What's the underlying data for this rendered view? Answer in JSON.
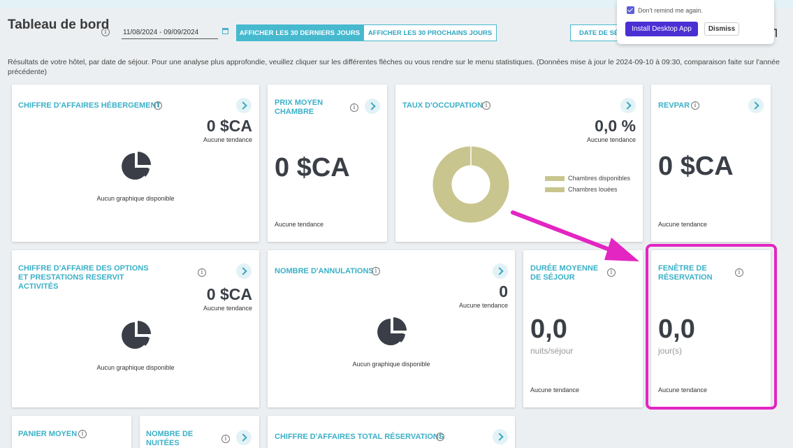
{
  "header": {
    "title": "Tableau de bord",
    "date_range": "11/08/2024 - 09/09/2024",
    "btn_last30": "AFFICHER LES 30 DERNIERS JOURS",
    "btn_next30": "AFFICHER LES 30 PROCHAINS JOURS",
    "btn_date": "DATE DE SÉJOUR"
  },
  "description": "Résultats de votre hôtel, par date de séjour. Pour une analyse plus approfondie, veuillez cliquer sur les différentes flèches ou vous rendre sur le menu statistiques. (Données mise à jour le 2024-09-10 à 09:30, comparaison faite sur l'année précédente)",
  "popup": {
    "remind_text": "Don't remind me again.",
    "remind_checked": true,
    "install_label": "Install Desktop App",
    "dismiss_label": "Dismiss"
  },
  "cards": {
    "ca_hebergement": {
      "title": "CHIFFRE D'AFFAIRES HÉBERGEMENT",
      "value": "0 $CA",
      "trend": "Aucune tendance",
      "no_chart": "Aucun graphique disponible"
    },
    "prix_moyen": {
      "title": "PRIX MOYEN CHAMBRE",
      "value": "0 $CA",
      "trend": "Aucune tendance"
    },
    "taux_occupation": {
      "title": "TAUX D'OCCUPATION",
      "value": "0,0 %",
      "trend": "Aucune tendance",
      "legend": [
        "Chambres disponibles",
        "Chambres louées"
      ],
      "color": "#c9c58e"
    },
    "revpar": {
      "title": "REVPAR",
      "value": "0 $CA",
      "trend": "Aucune tendance"
    },
    "ca_options": {
      "title": "CHIFFRE D'AFFAIRE DES OPTIONS ET PRESTATIONS RESERVIT ACTIVITÉS",
      "value": "0 $CA",
      "trend": "Aucune tendance",
      "no_chart": "Aucun graphique disponible"
    },
    "annulations": {
      "title": "NOMBRE D'ANNULATIONS",
      "value": "0",
      "trend": "Aucune tendance",
      "no_chart": "Aucun graphique disponible"
    },
    "duree_sejour": {
      "title": "DURÉE MOYENNE DE SÉJOUR",
      "value": "0,0",
      "unit": "nuits/séjour",
      "trend": "Aucune tendance"
    },
    "fenetre_reservation": {
      "title": "FENÊTRE DE RÉSERVATION",
      "value": "0,0",
      "unit": "jour(s)",
      "trend": "Aucune tendance"
    },
    "panier_moyen": {
      "title": "PANIER MOYEN"
    },
    "nombre_nuitees": {
      "title": "NOMBRE DE NUITÉES"
    },
    "ca_total": {
      "title": "CHIFFRE D'AFFAIRES TOTAL RÉSERVATIONS"
    }
  },
  "annotation": {
    "color": "#e325c2"
  }
}
